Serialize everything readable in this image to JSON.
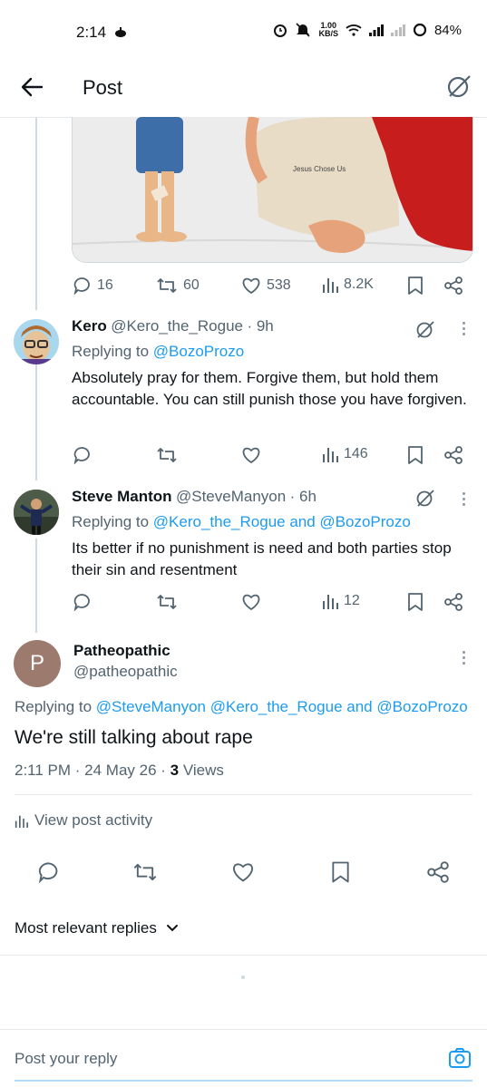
{
  "status_bar": {
    "time": "2:14",
    "net_speed_value": "1.00",
    "net_speed_unit": "KB/S",
    "battery": "84%"
  },
  "header": {
    "title": "Post"
  },
  "image": {
    "caption": "Jesus Chose Us"
  },
  "main_post_actions": {
    "replies": "16",
    "reposts": "60",
    "likes": "538",
    "views": "8.2K"
  },
  "replies": [
    {
      "name": "Kero",
      "handle": "@Kero_the_Rogue",
      "time": "· 9h",
      "replying_prefix": "Replying to",
      "replying_to": "@BozoProzo",
      "text": "Absolutely pray for them. Forgive them, but hold them accountable. You can still punish those you have forgiven.",
      "views": "146"
    },
    {
      "name": "Steve Manton",
      "handle": "@SteveManyon",
      "time": "· 6h",
      "replying_prefix": "Replying to",
      "replying_to": "@Kero_the_Rogue and @BozoProzo",
      "text": "Its better if no punishment is need and both parties stop their sin and resentment",
      "views": "12"
    }
  ],
  "focused_post": {
    "avatar_letter": "P",
    "name": "Patheopathic",
    "handle": "@patheopathic",
    "replying_prefix": "Replying to",
    "replying_to": "@SteveManyon @Kero_the_Rogue and @BozoProzo",
    "text": "We're still talking about rape",
    "timestamp": "2:11 PM · 24 May 26 · ",
    "views_count": "3",
    "views_label": "Views",
    "view_activity": "View post activity"
  },
  "sort": {
    "label": "Most relevant replies"
  },
  "composer": {
    "placeholder": "Post your reply"
  },
  "colors": {
    "accent": "#1d9bf0",
    "text": "#0f1419",
    "muted": "#536471",
    "border": "#e6e9ec",
    "avatar_p": "#9c7a6e"
  }
}
